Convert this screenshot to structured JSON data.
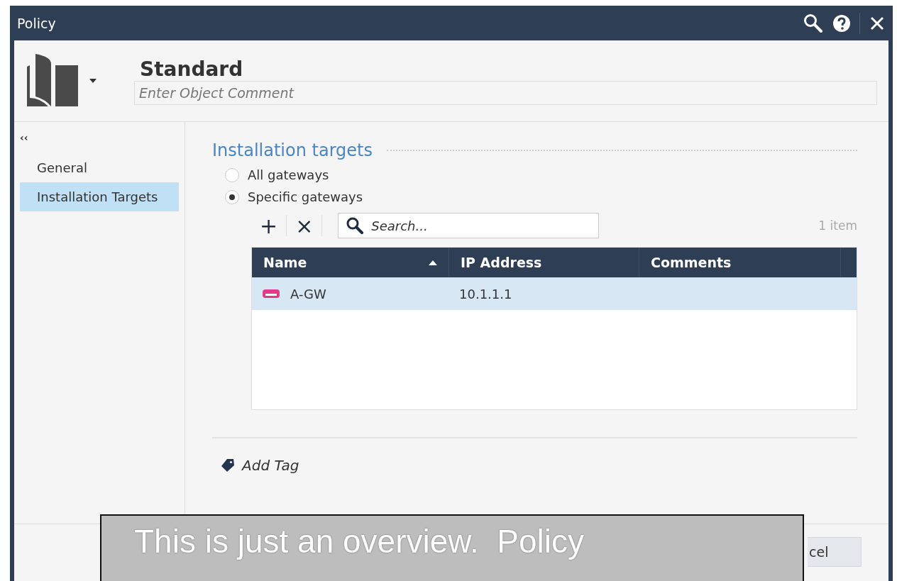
{
  "window": {
    "title": "Policy"
  },
  "header": {
    "name": "Standard",
    "comment": {
      "placeholder": "Enter Object Comment"
    }
  },
  "sidebar": {
    "collapse": "‹‹",
    "items": [
      {
        "label": "General",
        "selected": false
      },
      {
        "label": "Installation Targets",
        "selected": true
      }
    ]
  },
  "section": {
    "title": "Installation targets",
    "options": [
      {
        "label": "All gateways",
        "selected": false
      },
      {
        "label": "Specific gateways",
        "selected": true
      }
    ],
    "toolbar": {
      "add": "+",
      "remove": "×",
      "search": {
        "placeholder": "Search..."
      },
      "count": "1 item"
    },
    "table": {
      "columns": [
        {
          "label": "Name",
          "sorted": true
        },
        {
          "label": "IP Address",
          "sorted": false
        },
        {
          "label": "Comments",
          "sorted": false
        }
      ],
      "rows": [
        {
          "name": "A-GW",
          "ip": "10.1.1.1",
          "selected": true
        }
      ]
    }
  },
  "add_tag": "Add Tag",
  "footer": {
    "buttons": [
      "cel"
    ]
  },
  "callout": {
    "lines": [
      "This is just an overview.  Policy"
    ]
  }
}
